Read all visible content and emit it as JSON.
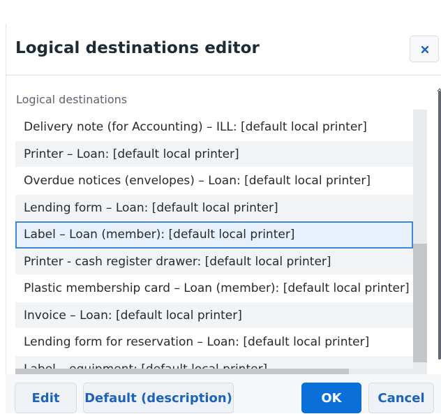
{
  "dialog": {
    "title": "Logical destinations editor",
    "close_icon": "close-icon"
  },
  "section": {
    "label": "Logical destinations"
  },
  "destinations": [
    "Delivery note (for Accounting) – ILL: [default local printer]",
    "Printer – Loan: [default local printer]",
    "Overdue notices (envelopes) – Loan: [default local printer]",
    "Lending form – Loan: [default local printer]",
    "Label – Loan (member): [default local printer]",
    "Printer - cash register drawer: [default local printer]",
    "Plastic membership card – Loan (member): [default local printer]",
    "Invoice – Loan: [default local printer]",
    "Lending form for reservation – Loan: [default local printer]",
    "Label – equipment: [default local printer]"
  ],
  "selected_index": 4,
  "footer": {
    "edit_label": "Edit",
    "default_label": "Default (description)",
    "ok_label": "OK",
    "cancel_label": "Cancel"
  },
  "colors": {
    "primary": "#0a6fd8",
    "selected_border": "#3d87d6",
    "selected_bg": "#e7f0fb",
    "link": "#1d63b8"
  }
}
